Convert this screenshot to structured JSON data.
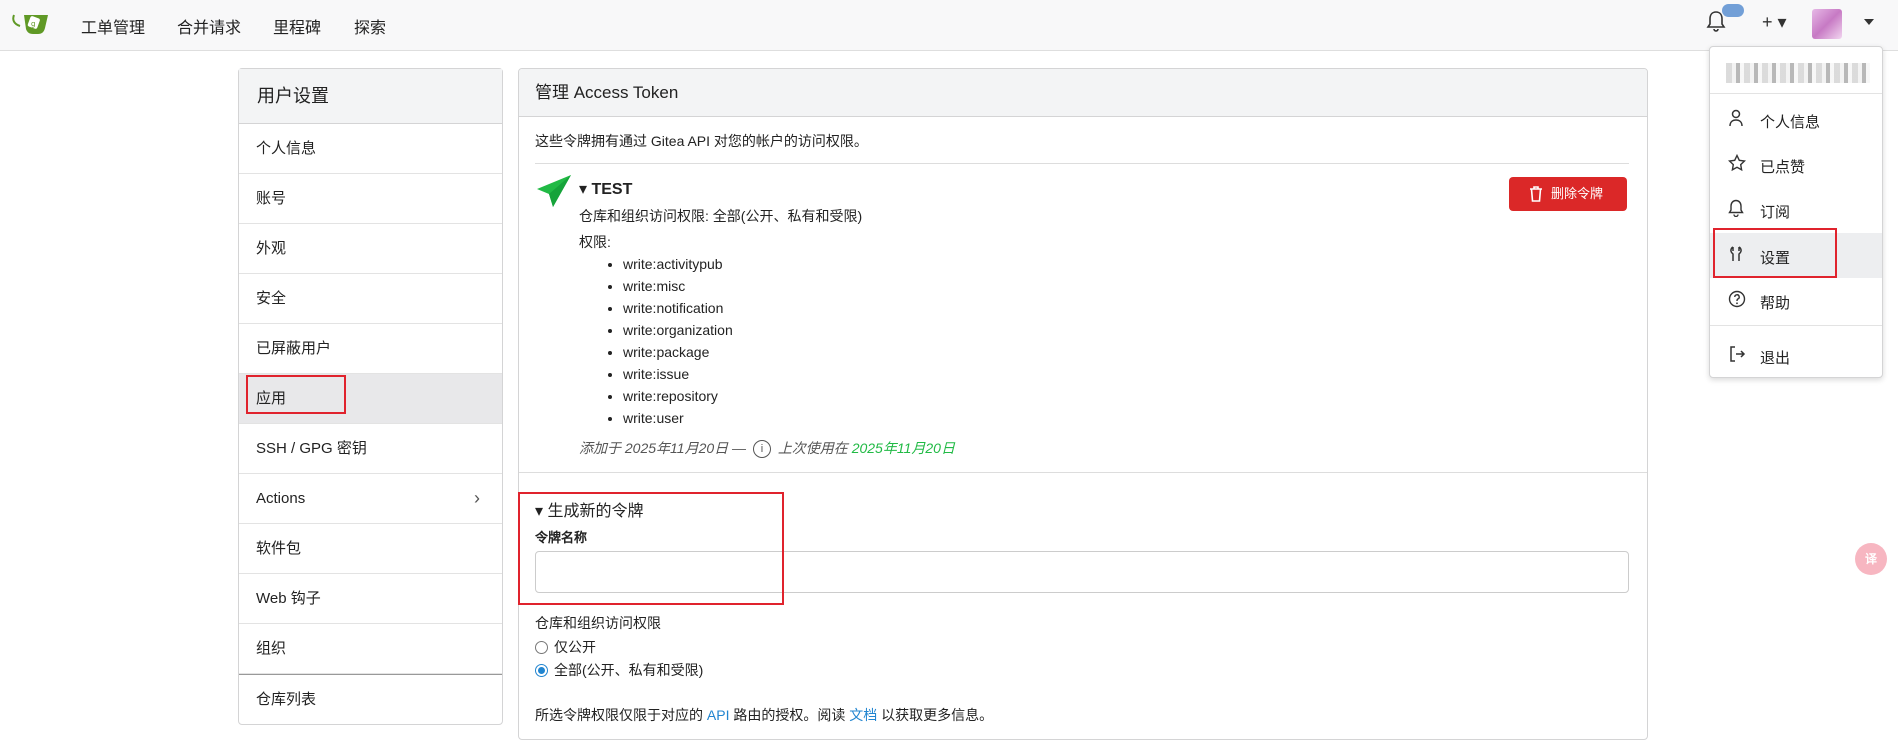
{
  "topbar": {
    "nav": [
      "工单管理",
      "合并请求",
      "里程碑",
      "探索"
    ],
    "brand_color": "#609926"
  },
  "sidebar": {
    "title": "用户设置",
    "items": [
      {
        "label": "个人信息"
      },
      {
        "label": "账号"
      },
      {
        "label": "外观"
      },
      {
        "label": "安全"
      },
      {
        "label": "已屏蔽用户"
      },
      {
        "label": "应用",
        "active": true
      },
      {
        "label": "SSH / GPG 密钥"
      },
      {
        "label": "Actions",
        "has_submenu": true
      },
      {
        "label": "软件包"
      },
      {
        "label": "Web 钩子"
      },
      {
        "label": "组织"
      },
      {
        "label": "仓库列表"
      }
    ]
  },
  "main": {
    "title": "管理 Access Token",
    "description": "这些令牌拥有通过 Gitea API 对您的帐户的访问权限。",
    "token": {
      "name": "▾ TEST",
      "scope": "仓库和组织访问权限: 全部(公开、私有和受限)",
      "perm_label": "权限:",
      "permissions": [
        "write:activitypub",
        "write:misc",
        "write:notification",
        "write:organization",
        "write:package",
        "write:issue",
        "write:repository",
        "write:user"
      ],
      "added": "添加于 2025年11月20日 —",
      "last_used_prefix": "上次使用在",
      "last_used_date": "2025年11月20日",
      "delete_label": "删除令牌"
    },
    "generate": {
      "title": "▾ 生成新的令牌",
      "name_label": "令牌名称",
      "name_value": "",
      "repo_access_label": "仓库和组织访问权限",
      "options": [
        "仅公开",
        "全部(公开、私有和受限)"
      ],
      "selected_option": 1,
      "note_prefix": "所选令牌权限仅限于对应的",
      "note_api": "API",
      "note_mid": "路由的授权。阅读",
      "note_docs": "文档",
      "note_suffix": "以获取更多信息。"
    }
  },
  "user_menu": {
    "items": [
      {
        "label": "个人信息",
        "icon": "person-icon"
      },
      {
        "label": "已点赞",
        "icon": "star-icon"
      },
      {
        "label": "订阅",
        "icon": "bell-icon"
      },
      {
        "label": "设置",
        "icon": "tools-icon",
        "active": true
      },
      {
        "label": "帮助",
        "icon": "question-icon"
      },
      {
        "label": "退出",
        "icon": "sign-out-icon"
      }
    ]
  },
  "translate_fab": "译"
}
